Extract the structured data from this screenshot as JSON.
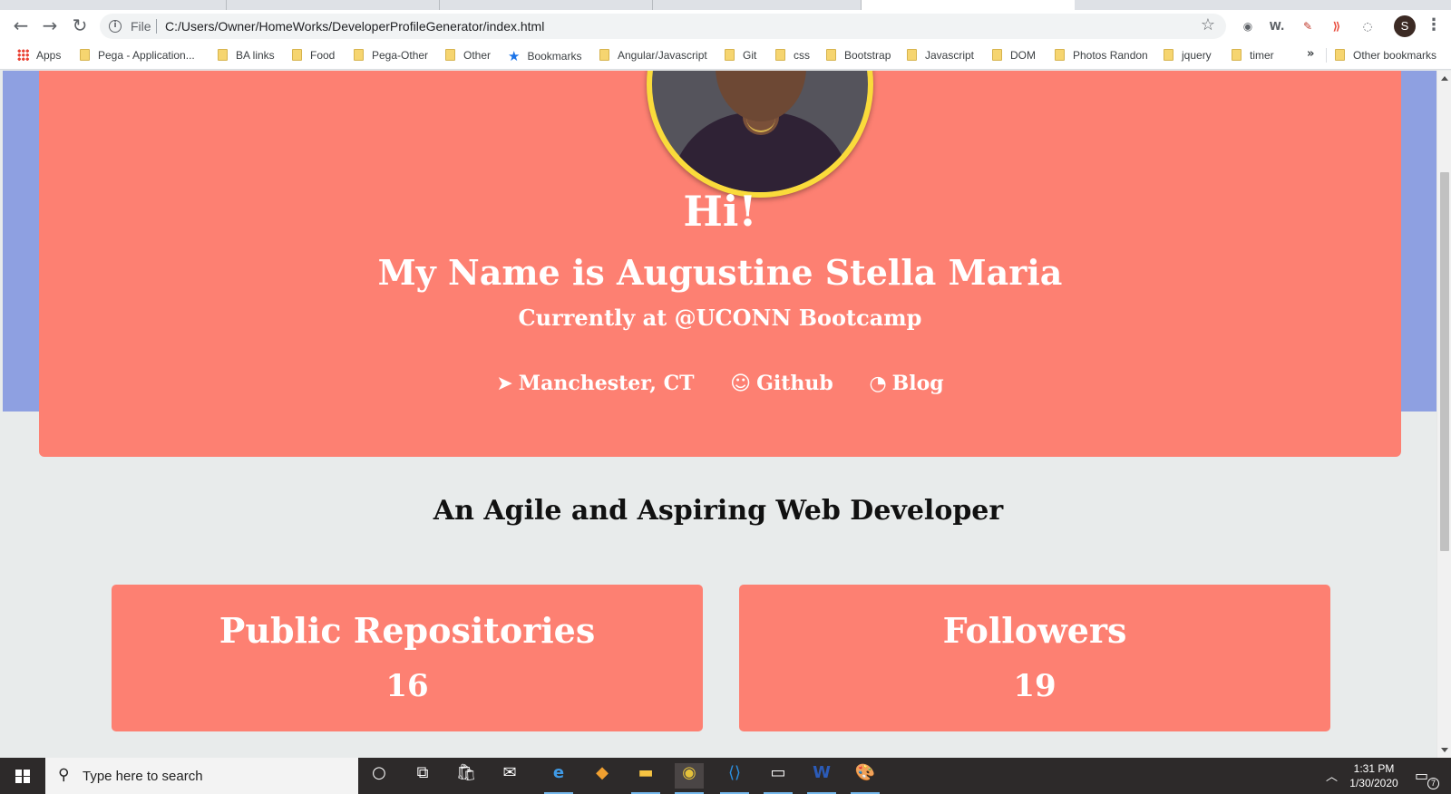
{
  "browser": {
    "file_label": "File",
    "url": "C:/Users/Owner/HomeWorks/DeveloperProfileGenerator/index.html",
    "profile_initial": "S",
    "extensions": [
      "opera-icon",
      "w-icon",
      "eyedropper-icon",
      "cast-icon",
      "reader-icon"
    ],
    "bookmarks": [
      {
        "label": "Apps",
        "type": "apps"
      },
      {
        "label": "Pega - Application...",
        "type": "folder"
      },
      {
        "label": "BA links",
        "type": "folder"
      },
      {
        "label": "Food",
        "type": "folder"
      },
      {
        "label": "Pega-Other",
        "type": "folder"
      },
      {
        "label": "Other",
        "type": "folder"
      },
      {
        "label": "Bookmarks",
        "type": "star"
      },
      {
        "label": "Angular/Javascript",
        "type": "folder"
      },
      {
        "label": "Git",
        "type": "folder"
      },
      {
        "label": "css",
        "type": "folder"
      },
      {
        "label": "Bootstrap",
        "type": "folder"
      },
      {
        "label": "Javascript",
        "type": "folder"
      },
      {
        "label": "DOM",
        "type": "folder"
      },
      {
        "label": "Photos Randon",
        "type": "folder"
      },
      {
        "label": "jquery",
        "type": "folder"
      },
      {
        "label": "timer",
        "type": "folder"
      }
    ],
    "more_bookmarks": "»",
    "other_bookmarks": "Other bookmarks"
  },
  "profile": {
    "greeting": "Hi!",
    "name_line": "My Name is Augustine Stella Maria",
    "current_line": "Currently at @UCONN Bootcamp",
    "links": [
      {
        "icon": "location-arrow-icon",
        "glyph": "➤",
        "label": "Manchester, CT"
      },
      {
        "icon": "github-icon",
        "glyph": "☺",
        "label": "Github"
      },
      {
        "icon": "rss-icon",
        "glyph": "◔",
        "label": "Blog"
      }
    ],
    "tagline": "An Agile and Aspiring Web Developer",
    "stats": [
      {
        "label": "Public Repositories",
        "value": "16"
      },
      {
        "label": "Followers",
        "value": "19"
      }
    ]
  },
  "colors": {
    "hero_background": "#8ea0e1",
    "card": "#fd8072",
    "avatar_border": "#fadb3b",
    "page_background": "#e8ebeb"
  },
  "taskbar": {
    "search_placeholder": "Type here to search",
    "time": "1:31 PM",
    "date": "1/30/2020",
    "notification_count": "7"
  }
}
